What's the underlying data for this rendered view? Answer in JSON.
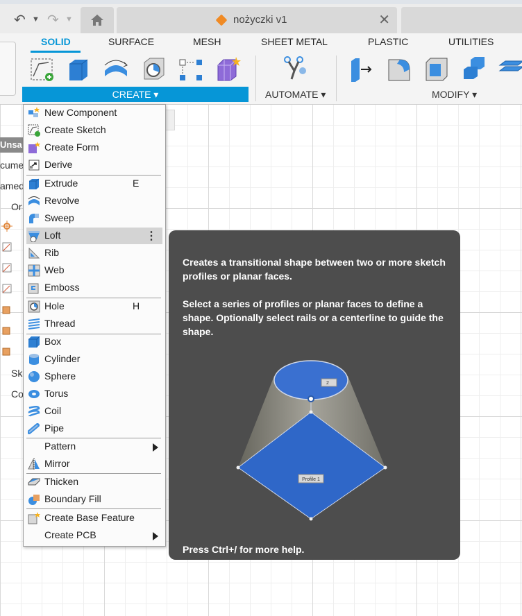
{
  "window": {
    "doc_title": "nożyczki v1",
    "undo_icon": "undo-icon",
    "redo_icon": "redo-icon",
    "home_icon": "home-icon",
    "close_icon": "close-icon"
  },
  "toolbar": {
    "tabs": [
      "SOLID",
      "SURFACE",
      "MESH",
      "SHEET METAL",
      "PLASTIC",
      "UTILITIES"
    ],
    "active_tab": "SOLID",
    "groups": {
      "create": "CREATE ▾",
      "automate": "AUTOMATE ▾",
      "modify": "MODIFY ▾"
    },
    "accent": "#0696d7"
  },
  "left_panel": {
    "header": "Unsa",
    "rows": [
      "cume",
      "amed",
      "Or",
      "Sk",
      "Co"
    ]
  },
  "menu": {
    "items": [
      {
        "label": "New Component",
        "shortcut": ""
      },
      {
        "label": "Create Sketch",
        "shortcut": ""
      },
      {
        "label": "Create Form",
        "shortcut": ""
      },
      {
        "label": "Derive",
        "shortcut": ""
      },
      {
        "label": "Extrude",
        "shortcut": "E"
      },
      {
        "label": "Revolve",
        "shortcut": ""
      },
      {
        "label": "Sweep",
        "shortcut": ""
      },
      {
        "label": "Loft",
        "shortcut": ""
      },
      {
        "label": "Rib",
        "shortcut": ""
      },
      {
        "label": "Web",
        "shortcut": ""
      },
      {
        "label": "Emboss",
        "shortcut": ""
      },
      {
        "label": "Hole",
        "shortcut": "H"
      },
      {
        "label": "Thread",
        "shortcut": ""
      },
      {
        "label": "Box",
        "shortcut": ""
      },
      {
        "label": "Cylinder",
        "shortcut": ""
      },
      {
        "label": "Sphere",
        "shortcut": ""
      },
      {
        "label": "Torus",
        "shortcut": ""
      },
      {
        "label": "Coil",
        "shortcut": ""
      },
      {
        "label": "Pipe",
        "shortcut": ""
      },
      {
        "label": "Pattern",
        "shortcut": ""
      },
      {
        "label": "Mirror",
        "shortcut": ""
      },
      {
        "label": "Thicken",
        "shortcut": ""
      },
      {
        "label": "Boundary Fill",
        "shortcut": ""
      },
      {
        "label": "Create Base Feature",
        "shortcut": ""
      },
      {
        "label": "Create PCB",
        "shortcut": ""
      }
    ],
    "highlighted": "Loft"
  },
  "tooltip": {
    "line1": "Creates a transitional shape between two or more sketch profiles or planar faces.",
    "line2": "Select a series of profiles or planar faces to define a shape. Optionally select rails or a centerline to guide the shape.",
    "footer": "Press Ctrl+/ for more help.",
    "profile_label_1": "Profile 1",
    "profile_label_2": "2"
  }
}
